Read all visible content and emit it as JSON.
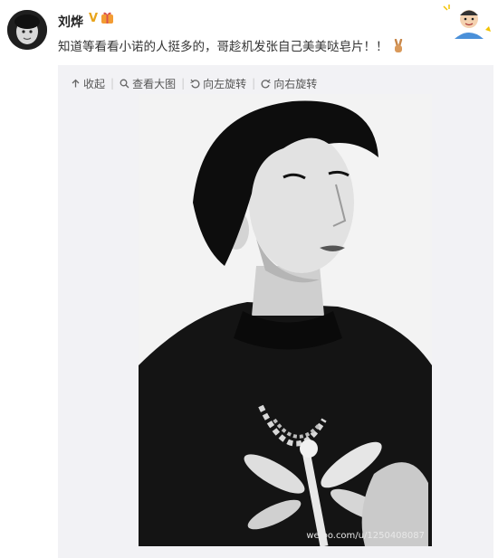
{
  "post": {
    "username": "刘烨",
    "verified_mark": "V",
    "text": "知道等看看小诺的人挺多的，哥趁机发张自己美美哒皂片！！",
    "emoji": "victory-hand"
  },
  "toolbar": {
    "collapse": "收起",
    "view_large": "查看大图",
    "rotate_left": "向左旋转",
    "rotate_right": "向右旋转"
  },
  "photo": {
    "watermark": "weibo.com/u/1250408087"
  },
  "colors": {
    "accent": "#e8a41b",
    "panel_bg": "#f2f2f5",
    "text": "#333333"
  }
}
